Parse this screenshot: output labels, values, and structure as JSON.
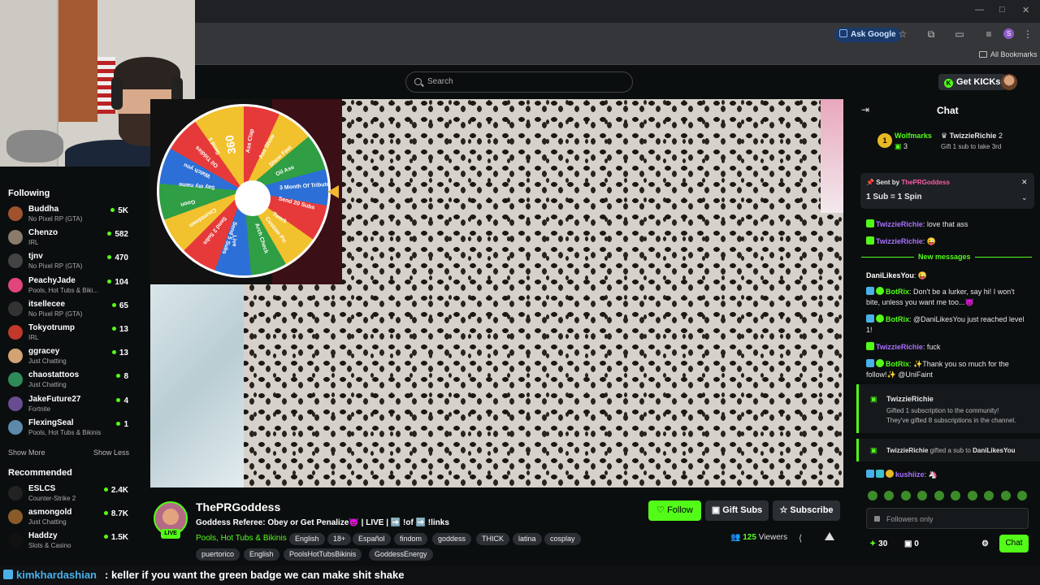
{
  "browser": {
    "ask_google": "Ask Google",
    "all_bookmarks": "All Bookmarks",
    "profile_initial": "S"
  },
  "header": {
    "search_placeholder": "Search",
    "get_kicks": "Get KICKs"
  },
  "sidebar": {
    "following_title": "Following",
    "items": [
      {
        "name": "Buddha",
        "category": "No Pixel RP (GTA)",
        "viewers": "5K",
        "color": "#a0522d"
      },
      {
        "name": "Chenzo",
        "category": "IRL",
        "viewers": "582",
        "color": "#8a7b6a"
      },
      {
        "name": "tjnv",
        "category": "No Pixel RP (GTA)",
        "viewers": "470",
        "color": "#444444"
      },
      {
        "name": "PeachyJade",
        "category": "Pools, Hot Tubs & Biki...",
        "viewers": "104",
        "color": "#e0457b"
      },
      {
        "name": "itsellecee",
        "category": "No Pixel RP (GTA)",
        "viewers": "65",
        "color": "#333333"
      },
      {
        "name": "Tokyotrump",
        "category": "IRL",
        "viewers": "13",
        "color": "#c0392b"
      },
      {
        "name": "ggracey",
        "category": "Just Chatting",
        "viewers": "13",
        "color": "#d4a373"
      },
      {
        "name": "chaostattoos",
        "category": "Just Chatting",
        "viewers": "8",
        "color": "#2e8b57"
      },
      {
        "name": "JakeFuture27",
        "category": "Fortnite",
        "viewers": "4",
        "color": "#6a4c93"
      },
      {
        "name": "FlexingSeal",
        "category": "Pools, Hot Tubs & Bikinis",
        "viewers": "1",
        "color": "#5d8aa8"
      }
    ],
    "show_more": "Show More",
    "show_less": "Show Less",
    "recommended_title": "Recommended",
    "recommended": [
      {
        "name": "ESLCS",
        "category": "Counter-Strike 2",
        "viewers": "2.4K",
        "color": "#222222"
      },
      {
        "name": "asmongold",
        "category": "Just Chatting",
        "viewers": "8.7K",
        "color": "#8b5a2b"
      },
      {
        "name": "Haddzy",
        "category": "Slots & Casino",
        "viewers": "1.5K",
        "color": "#111111"
      }
    ]
  },
  "wheel": {
    "labels": [
      "Ass Clap",
      "Ass Show",
      "Show Feet",
      "Oil Ass",
      "3 Month Of Tribute",
      "Send 20 Subs",
      "Twerk",
      "Custom Pic",
      "Arch Check",
      "Live",
      "Send 5 Subs",
      "Send 2 Subs",
      "Countdown",
      "Goon",
      "Say my name",
      "Watch you",
      "Oil Tiddies",
      "Send 5",
      "360"
    ]
  },
  "stream": {
    "live": "LIVE",
    "streamer": "ThePRGoddess",
    "title": "Goddess Referee: Obey or Get Penalize😈 | LIVE | ➡️ !of ➡️ !links",
    "category": "Pools, Hot Tubs & Bikinis",
    "tags": [
      "English",
      "18+",
      "Español",
      "findom",
      "goddess",
      "THICK",
      "latina",
      "cosplay",
      "puertorico",
      "English",
      "PoolsHotTubsBikinis",
      "GoddessEnergy"
    ],
    "follow": "Follow",
    "gift_subs": "Gift Subs",
    "subscribe": "Subscribe",
    "viewers_count": "125",
    "viewers_label": "Viewers"
  },
  "chat": {
    "title": "Chat",
    "leader1_rank": "1",
    "leader1_name": "Wolfmarks",
    "leader1_count": "3",
    "leader2_name": "TwizzieRichie",
    "leader2_count": "2",
    "leader2_sub": "Gift 1 sub to take 3rd",
    "pinned_sent_by": "Sent by",
    "pinned_user": "ThePRGoddess",
    "pinned_text": "1 Sub = 1 Spin",
    "new_messages": "New messages",
    "messages": [
      {
        "user": "TwizzieRichie",
        "text": ": love that ass"
      },
      {
        "user": "TwizzieRichie",
        "text": ": 😜"
      },
      {
        "user": "DaniLikesYou",
        "text": ": 😜"
      },
      {
        "user": "BotRix",
        "text": ": Don't be a lurker, say hi! I won't bite, unless you want me too...😈"
      },
      {
        "user": "BotRix",
        "text": ": @DaniLikesYou just reached level 1!"
      },
      {
        "user": "TwizzieRichie",
        "text": ": fuck"
      },
      {
        "user": "BotRix",
        "text": ": ✨Thank you so much for the follow!✨ @UniFaint"
      }
    ],
    "sub_card_user": "TwizzieRichie",
    "sub_card_line1": "Gifted 1 subscription to the community!",
    "sub_card_line2": "They've gifted 8 subscriptions in the channel.",
    "gift_user": "TwizzieRichie",
    "gift_mid": "gifted a sub to",
    "gift_target": "DaniLikesYou",
    "last_user": "kushiize",
    "last_text": ": 🦄",
    "followers_only": "Followers only",
    "points": "30",
    "gifts": "0",
    "chat_button": "Chat"
  },
  "overlay": {
    "user": "kimkhardashian",
    "message": ": keller if you want the green badge we can make shit shake"
  }
}
